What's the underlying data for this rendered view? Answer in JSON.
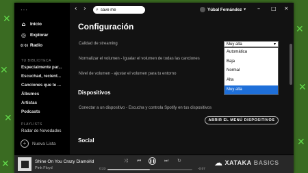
{
  "sidebar": {
    "menu_glyph": "···",
    "nav": [
      {
        "label": "Inicio",
        "icon": "home-icon",
        "glyph": "⌂"
      },
      {
        "label": "Explorar",
        "icon": "browse-icon",
        "glyph": "◎"
      },
      {
        "label": "Radio",
        "icon": "radio-icon",
        "glyph": "((·))"
      }
    ],
    "library_title": "TU BIBLIOTECA",
    "library": [
      "Especialmente par...",
      "Escuchad, recient...",
      "Canciones que te ...",
      "Álbumes",
      "Artistas",
      "Podcasts"
    ],
    "playlists_title": "PLAYLISTS",
    "playlists": [
      "Radar de Novedades"
    ],
    "new_list": "Nueva Lista",
    "new_list_glyph": "+"
  },
  "topbar": {
    "back_glyph": "‹",
    "forward_glyph": "›",
    "search_glyph": "⌕",
    "search_value": "save me",
    "user_name": "Yúbal Fernández",
    "chevron_glyph": "▾",
    "minimize_glyph": "–",
    "maximize_glyph": "□",
    "close_glyph": "✕"
  },
  "settings": {
    "title": "Configuración",
    "streaming_label": "Calidad de streaming",
    "normalize_label": "Normalizar el volumen - Igualar el volumen de todas las canciones",
    "volume_level_label": "Nivel de volumen - ajustar el volumen para tu entorno",
    "quality_selected": "Muy alta",
    "select_chevron": "▾",
    "quality_options": [
      "Automática",
      "Baja",
      "Normal",
      "Alta",
      "Muy alta"
    ],
    "devices_title": "Dispositivos",
    "devices_label": "Conectar a un dispositivo - Escucha y controla Spotify en tus dispositivos",
    "devices_button": "ABRIR EL MENÚ DISPOSITIVOS",
    "social_title": "Social"
  },
  "player": {
    "track_title": "Shine On You Crazy Diamond",
    "artist": "Pink Floyd",
    "elapsed": "0:23",
    "remaining": "-0:07",
    "progress": 0.5,
    "heart_glyph": "♡",
    "shuffle_glyph": "⤨",
    "prev_glyph": "⏮",
    "play_glyph": "❚❚",
    "next_glyph": "⏭",
    "repeat_glyph": "↻"
  },
  "watermark": {
    "logo_glyph": "☁",
    "brand": "XATAKA",
    "sub": "BASICS"
  },
  "colors": {
    "background_green": "#3a6b22",
    "accent_selected": "#1e6fd9"
  }
}
